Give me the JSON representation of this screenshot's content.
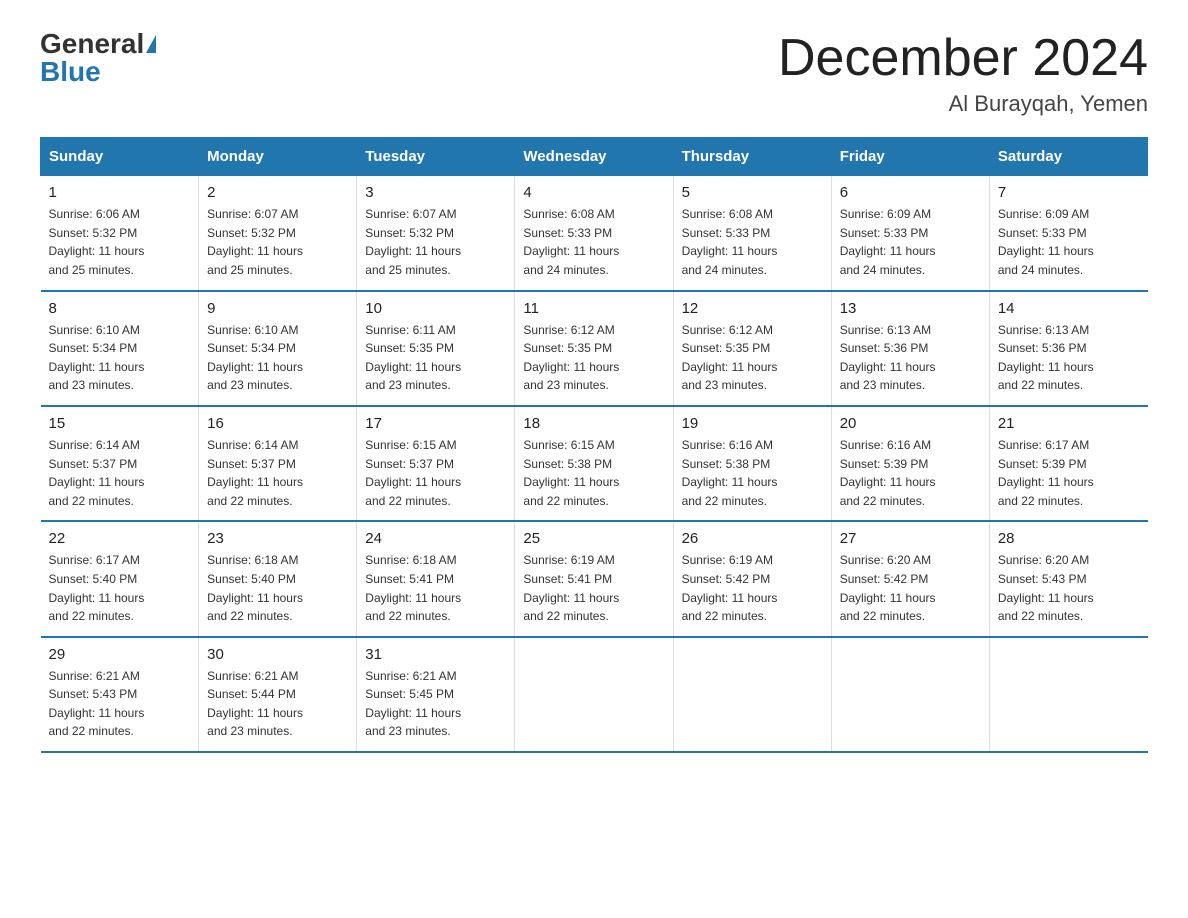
{
  "header": {
    "logo_general": "General",
    "logo_blue": "Blue",
    "month": "December 2024",
    "location": "Al Burayqah, Yemen"
  },
  "days_of_week": [
    "Sunday",
    "Monday",
    "Tuesday",
    "Wednesday",
    "Thursday",
    "Friday",
    "Saturday"
  ],
  "weeks": [
    [
      {
        "day": "1",
        "info": "Sunrise: 6:06 AM\nSunset: 5:32 PM\nDaylight: 11 hours\nand 25 minutes."
      },
      {
        "day": "2",
        "info": "Sunrise: 6:07 AM\nSunset: 5:32 PM\nDaylight: 11 hours\nand 25 minutes."
      },
      {
        "day": "3",
        "info": "Sunrise: 6:07 AM\nSunset: 5:32 PM\nDaylight: 11 hours\nand 25 minutes."
      },
      {
        "day": "4",
        "info": "Sunrise: 6:08 AM\nSunset: 5:33 PM\nDaylight: 11 hours\nand 24 minutes."
      },
      {
        "day": "5",
        "info": "Sunrise: 6:08 AM\nSunset: 5:33 PM\nDaylight: 11 hours\nand 24 minutes."
      },
      {
        "day": "6",
        "info": "Sunrise: 6:09 AM\nSunset: 5:33 PM\nDaylight: 11 hours\nand 24 minutes."
      },
      {
        "day": "7",
        "info": "Sunrise: 6:09 AM\nSunset: 5:33 PM\nDaylight: 11 hours\nand 24 minutes."
      }
    ],
    [
      {
        "day": "8",
        "info": "Sunrise: 6:10 AM\nSunset: 5:34 PM\nDaylight: 11 hours\nand 23 minutes."
      },
      {
        "day": "9",
        "info": "Sunrise: 6:10 AM\nSunset: 5:34 PM\nDaylight: 11 hours\nand 23 minutes."
      },
      {
        "day": "10",
        "info": "Sunrise: 6:11 AM\nSunset: 5:35 PM\nDaylight: 11 hours\nand 23 minutes."
      },
      {
        "day": "11",
        "info": "Sunrise: 6:12 AM\nSunset: 5:35 PM\nDaylight: 11 hours\nand 23 minutes."
      },
      {
        "day": "12",
        "info": "Sunrise: 6:12 AM\nSunset: 5:35 PM\nDaylight: 11 hours\nand 23 minutes."
      },
      {
        "day": "13",
        "info": "Sunrise: 6:13 AM\nSunset: 5:36 PM\nDaylight: 11 hours\nand 23 minutes."
      },
      {
        "day": "14",
        "info": "Sunrise: 6:13 AM\nSunset: 5:36 PM\nDaylight: 11 hours\nand 22 minutes."
      }
    ],
    [
      {
        "day": "15",
        "info": "Sunrise: 6:14 AM\nSunset: 5:37 PM\nDaylight: 11 hours\nand 22 minutes."
      },
      {
        "day": "16",
        "info": "Sunrise: 6:14 AM\nSunset: 5:37 PM\nDaylight: 11 hours\nand 22 minutes."
      },
      {
        "day": "17",
        "info": "Sunrise: 6:15 AM\nSunset: 5:37 PM\nDaylight: 11 hours\nand 22 minutes."
      },
      {
        "day": "18",
        "info": "Sunrise: 6:15 AM\nSunset: 5:38 PM\nDaylight: 11 hours\nand 22 minutes."
      },
      {
        "day": "19",
        "info": "Sunrise: 6:16 AM\nSunset: 5:38 PM\nDaylight: 11 hours\nand 22 minutes."
      },
      {
        "day": "20",
        "info": "Sunrise: 6:16 AM\nSunset: 5:39 PM\nDaylight: 11 hours\nand 22 minutes."
      },
      {
        "day": "21",
        "info": "Sunrise: 6:17 AM\nSunset: 5:39 PM\nDaylight: 11 hours\nand 22 minutes."
      }
    ],
    [
      {
        "day": "22",
        "info": "Sunrise: 6:17 AM\nSunset: 5:40 PM\nDaylight: 11 hours\nand 22 minutes."
      },
      {
        "day": "23",
        "info": "Sunrise: 6:18 AM\nSunset: 5:40 PM\nDaylight: 11 hours\nand 22 minutes."
      },
      {
        "day": "24",
        "info": "Sunrise: 6:18 AM\nSunset: 5:41 PM\nDaylight: 11 hours\nand 22 minutes."
      },
      {
        "day": "25",
        "info": "Sunrise: 6:19 AM\nSunset: 5:41 PM\nDaylight: 11 hours\nand 22 minutes."
      },
      {
        "day": "26",
        "info": "Sunrise: 6:19 AM\nSunset: 5:42 PM\nDaylight: 11 hours\nand 22 minutes."
      },
      {
        "day": "27",
        "info": "Sunrise: 6:20 AM\nSunset: 5:42 PM\nDaylight: 11 hours\nand 22 minutes."
      },
      {
        "day": "28",
        "info": "Sunrise: 6:20 AM\nSunset: 5:43 PM\nDaylight: 11 hours\nand 22 minutes."
      }
    ],
    [
      {
        "day": "29",
        "info": "Sunrise: 6:21 AM\nSunset: 5:43 PM\nDaylight: 11 hours\nand 22 minutes."
      },
      {
        "day": "30",
        "info": "Sunrise: 6:21 AM\nSunset: 5:44 PM\nDaylight: 11 hours\nand 23 minutes."
      },
      {
        "day": "31",
        "info": "Sunrise: 6:21 AM\nSunset: 5:45 PM\nDaylight: 11 hours\nand 23 minutes."
      },
      {
        "day": "",
        "info": ""
      },
      {
        "day": "",
        "info": ""
      },
      {
        "day": "",
        "info": ""
      },
      {
        "day": "",
        "info": ""
      }
    ]
  ]
}
